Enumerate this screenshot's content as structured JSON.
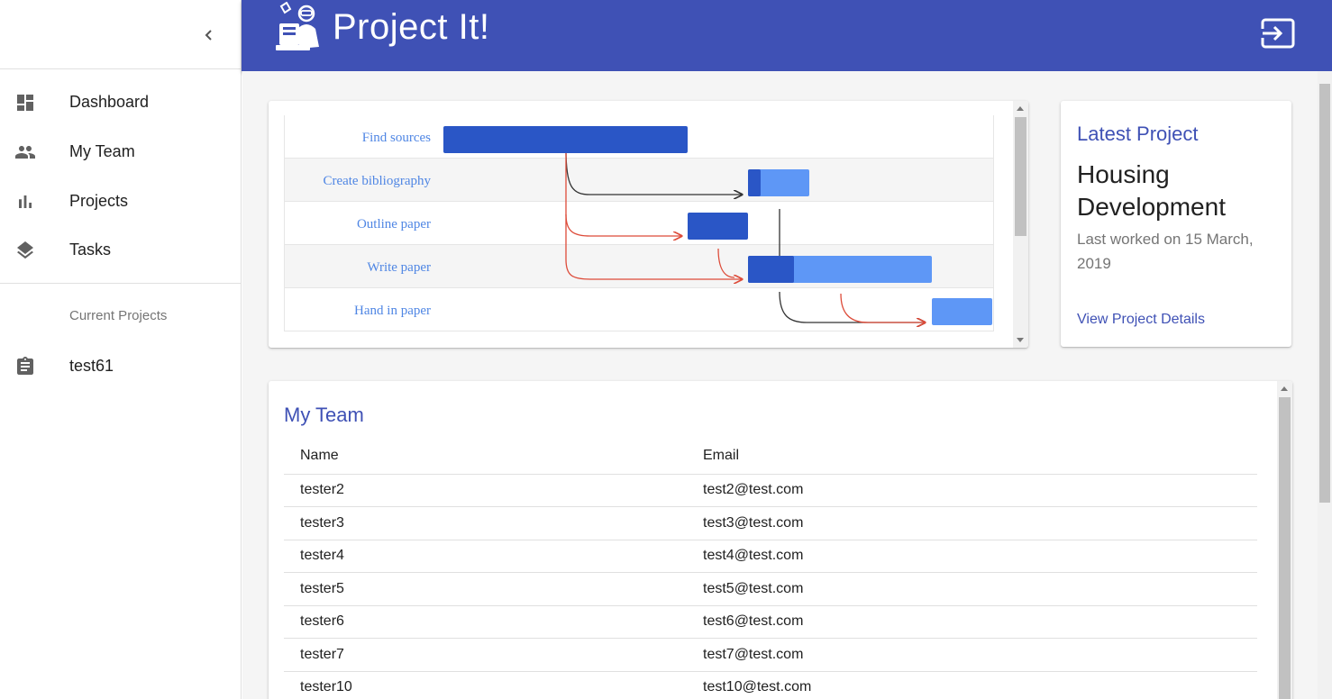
{
  "app": {
    "title": "Project It!"
  },
  "sidebar": {
    "items": [
      {
        "label": "Dashboard",
        "icon": "dashboard-icon"
      },
      {
        "label": "My Team",
        "icon": "people-icon"
      },
      {
        "label": "Projects",
        "icon": "bar-chart-icon"
      },
      {
        "label": "Tasks",
        "icon": "layers-icon"
      }
    ],
    "subheader": "Current Projects",
    "projects": [
      {
        "label": "test61",
        "icon": "clipboard-icon"
      }
    ]
  },
  "gantt": {
    "tasks": [
      {
        "label": "Find sources"
      },
      {
        "label": "Create bibliography"
      },
      {
        "label": "Outline paper"
      },
      {
        "label": "Write paper"
      },
      {
        "label": "Hand in paper"
      }
    ],
    "colors": {
      "bar_dark": "#2a56c6",
      "bar_light": "#5e97f6",
      "arrow_dark": "#333333",
      "arrow_red": "#dd4b39"
    }
  },
  "latest_project": {
    "heading": "Latest Project",
    "name": "Housing Development",
    "meta": "Last worked on 15 March, 2019",
    "link": "View Project Details"
  },
  "team": {
    "heading": "My Team",
    "columns": [
      "Name",
      "Email"
    ],
    "rows": [
      [
        "tester2",
        "test2@test.com"
      ],
      [
        "tester3",
        "test3@test.com"
      ],
      [
        "tester4",
        "test4@test.com"
      ],
      [
        "tester5",
        "test5@test.com"
      ],
      [
        "tester6",
        "test6@test.com"
      ],
      [
        "tester7",
        "test7@test.com"
      ],
      [
        "tester10",
        "test10@test.com"
      ]
    ]
  },
  "colors": {
    "primary": "#3f51b5",
    "background": "#f5f5f5"
  }
}
